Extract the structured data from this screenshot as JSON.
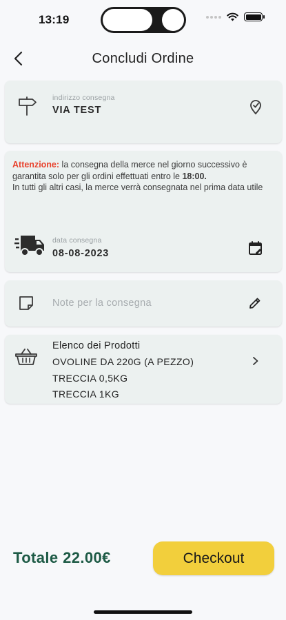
{
  "status_bar": {
    "time": "13:19"
  },
  "header": {
    "title": "Concludi Ordine"
  },
  "address": {
    "label": "indirizzo consegna",
    "value": "VIA TEST"
  },
  "notice": {
    "warning_prefix": "Attenzione:",
    "line1": " la consegna della merce  nel giorno successivo è garantita solo per gli ordini effettuati entro le ",
    "time": "18:00.",
    "line2": "In tutti gli altri casi, la merce verrà consegnata nel prima data utile"
  },
  "delivery_date": {
    "label": "data consegna",
    "value": "08-08-2023"
  },
  "notes": {
    "placeholder": "Note per la consegna"
  },
  "products": {
    "title": "Elenco dei Prodotti",
    "items": [
      "OVOLINE DA 220G (A PEZZO)",
      "TRECCIA 0,5KG",
      "TRECCIA 1KG"
    ]
  },
  "footer": {
    "total": "Totale 22.00€",
    "checkout_label": "Checkout"
  },
  "colors": {
    "accent": "#f2cf3c",
    "total_text": "#1d5a45",
    "warning": "#e8412c",
    "card_bg": "#ecf1f0"
  },
  "icons": {
    "back": "chevron-left-icon",
    "address": "signpost-icon",
    "location": "location-check-icon",
    "truck": "delivery-truck-icon",
    "calendar": "calendar-edit-icon",
    "note": "sticky-note-icon",
    "edit": "pencil-icon",
    "basket": "basket-icon",
    "chevron": "chevron-right-icon"
  }
}
